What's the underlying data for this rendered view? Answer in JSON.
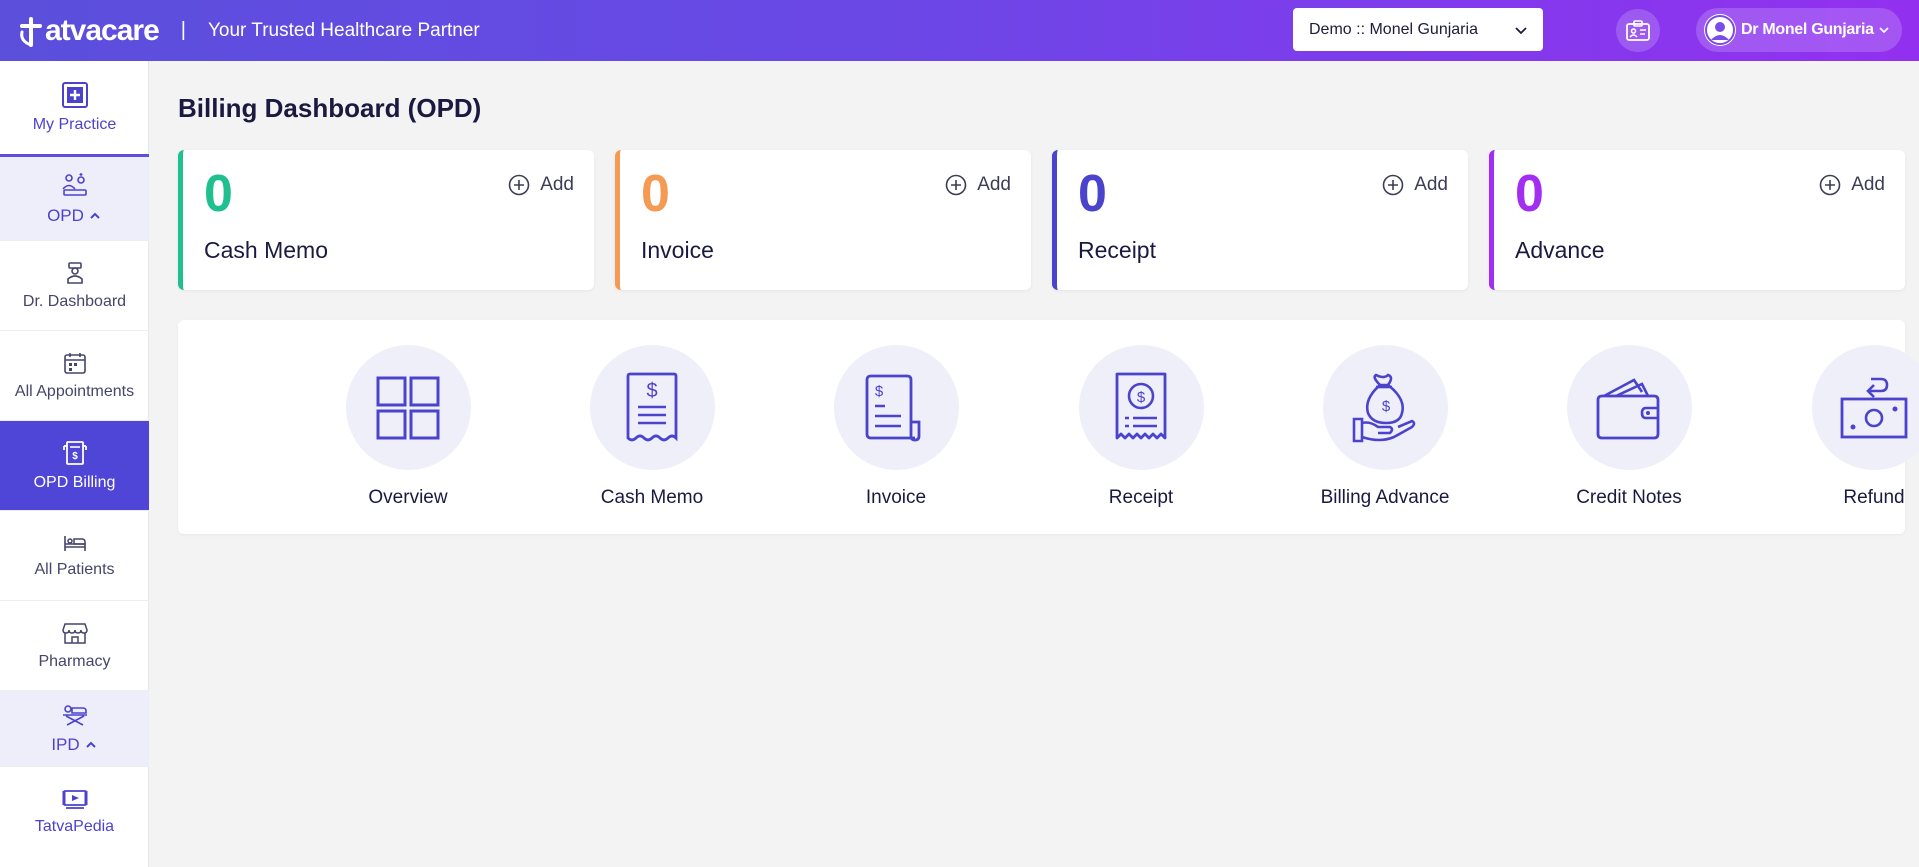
{
  "header": {
    "logo_text": "atvacare",
    "tagline": "Your Trusted Healthcare Partner",
    "separator": "|",
    "org_select": "Demo :: Monel Gunjaria",
    "user_name": "Dr Monel Gunjaria"
  },
  "sidebar": {
    "items": [
      {
        "label": "My Practice",
        "icon": "plus-square-icon"
      },
      {
        "label": "OPD",
        "icon": "opd-icon"
      },
      {
        "label": "Dr. Dashboard",
        "icon": "doctor-icon"
      },
      {
        "label": "All Appointments",
        "icon": "calendar-icon"
      },
      {
        "label": "OPD Billing",
        "icon": "bill-icon"
      },
      {
        "label": "All Patients",
        "icon": "bed-icon"
      },
      {
        "label": "Pharmacy",
        "icon": "store-icon"
      },
      {
        "label": "IPD",
        "icon": "ipd-icon"
      },
      {
        "label": "TatvaPedia",
        "icon": "video-icon"
      }
    ]
  },
  "page": {
    "title": "Billing Dashboard (OPD)"
  },
  "stats": [
    {
      "count": "0",
      "label": "Cash Memo",
      "add": "Add",
      "color": "#1fbf8f"
    },
    {
      "count": "0",
      "label": "Invoice",
      "add": "Add",
      "color": "#f59a52"
    },
    {
      "count": "0",
      "label": "Receipt",
      "add": "Add",
      "color": "#4c43cc"
    },
    {
      "count": "0",
      "label": "Advance",
      "add": "Add",
      "color": "#a12ef0"
    }
  ],
  "actions": [
    {
      "label": "Overview",
      "icon": "grid-icon"
    },
    {
      "label": "Cash Memo",
      "icon": "cash-memo-icon"
    },
    {
      "label": "Invoice",
      "icon": "invoice-icon"
    },
    {
      "label": "Receipt",
      "icon": "receipt-icon"
    },
    {
      "label": "Billing Advance",
      "icon": "money-bag-icon"
    },
    {
      "label": "Credit Notes",
      "icon": "wallet-icon"
    },
    {
      "label": "Refund",
      "icon": "refund-icon"
    }
  ],
  "colors": {
    "accent": "#4c43cc",
    "header_start": "#5b4fdc",
    "header_end": "#9330f0"
  }
}
